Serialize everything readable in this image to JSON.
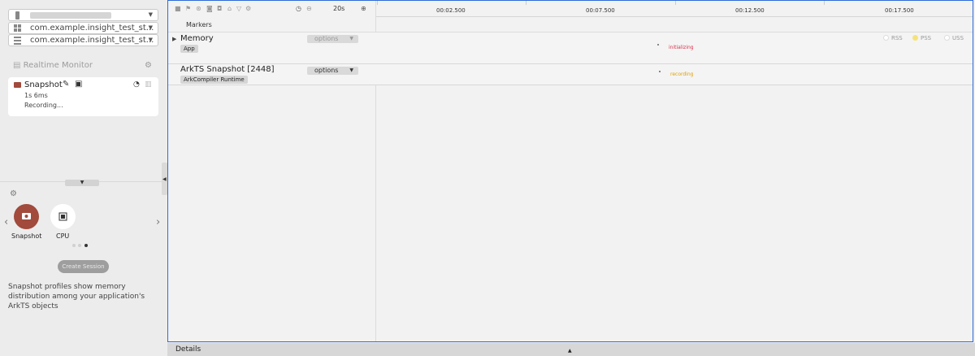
{
  "device_select": {
    "value": "",
    "icon": "phone-icon"
  },
  "app_select": {
    "value": "com.example.insight_test_st...",
    "icon": "apps-icon"
  },
  "process_select": {
    "value": "com.example.insight_test_st...",
    "icon": "process-icon"
  },
  "realtime_monitor": {
    "label": "Realtime Monitor"
  },
  "session_card": {
    "title": "Snapshot",
    "duration": "1s 6ms",
    "status": "Recording..."
  },
  "tools": [
    {
      "label": "Snapshot",
      "color": "#a24a3c"
    },
    {
      "label": "CPU",
      "color": "#ffffff"
    }
  ],
  "create_session_button": "Create Session",
  "description": "Snapshot profiles show memory distribution among your application's ArkTS objects",
  "toolbar": {
    "duration": "20s"
  },
  "ruler": {
    "ticks": [
      "00:02.500",
      "00:07.500",
      "00:12.500",
      "00:17.500"
    ]
  },
  "markers_label": "Markers",
  "tracks": [
    {
      "title": "Memory",
      "tag": "App",
      "options": "options",
      "event": "initializing",
      "event_color": "#d9304a"
    },
    {
      "title": "ArkTS Snapshot [2448]",
      "tag": "ArkCompiler Runtime",
      "options": "options",
      "event": "recording",
      "event_color": "#e0a000"
    }
  ],
  "legend": [
    {
      "label": "RSS",
      "color": "#ffffff"
    },
    {
      "label": "PSS",
      "color": "#f5e37a"
    },
    {
      "label": "USS",
      "color": "#ffffff"
    }
  ],
  "details_label": "Details"
}
